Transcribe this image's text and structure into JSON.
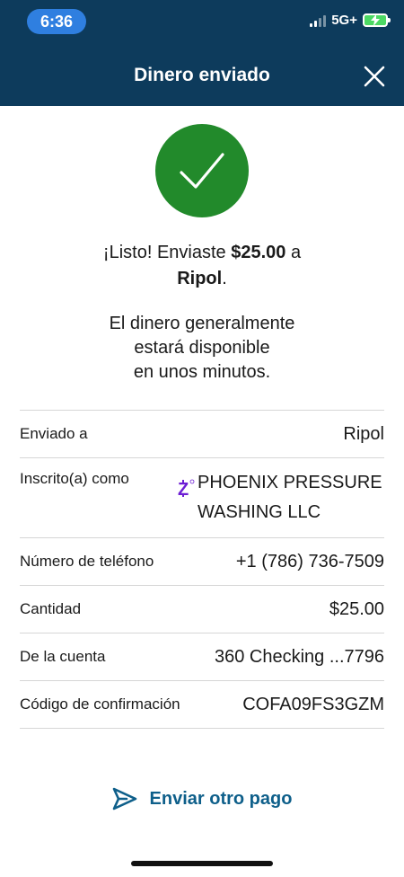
{
  "status_bar": {
    "time": "6:36",
    "network": "5G+",
    "signal_bars_active": 2,
    "signal_bars_total": 4,
    "battery": "charging"
  },
  "header": {
    "title": "Dinero enviado",
    "close_icon": "close-icon",
    "background": "#0d3b5c"
  },
  "confirmation": {
    "icon": "checkmark-icon",
    "icon_background": "#228a2b",
    "message_prefix": "¡Listo! Enviaste ",
    "amount": "$25.00",
    "message_mid": " a",
    "recipient": "Ripol",
    "message_suffix": ".",
    "availability_line1": "El dinero generalmente",
    "availability_line2": "estará disponible",
    "availability_line3": "en unos minutos."
  },
  "details": {
    "sent_to": {
      "label": "Enviado a",
      "value": "Ripol"
    },
    "enrolled_as": {
      "label": "Inscrito(a) como",
      "icon": "zelle-icon",
      "icon_color": "#6d1ed4",
      "value_line1": "PHOENIX PRESSURE",
      "value_line2": "WASHING LLC"
    },
    "phone": {
      "label": "Número de teléfono",
      "value": "+1 (786) 736-7509"
    },
    "amount": {
      "label": "Cantidad",
      "value": "$25.00"
    },
    "from_account": {
      "label": "De la cuenta",
      "value": "360 Checking ...7796"
    },
    "confirmation_code": {
      "label": "Código de confirmación",
      "value": "COFA09FS3GZM"
    }
  },
  "actions": {
    "send_again_icon": "send-icon",
    "send_again_label": "Enviar otro pago",
    "accent": "#0e5f8a"
  }
}
